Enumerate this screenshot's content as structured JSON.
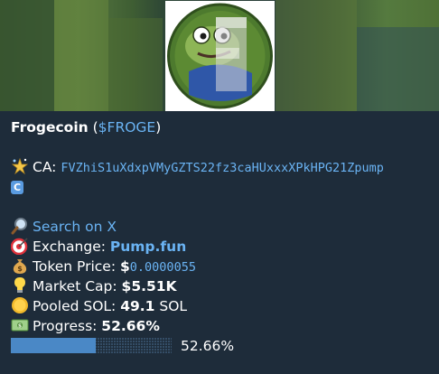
{
  "token": {
    "name": "Frogecoin",
    "ticker_open": " (",
    "ticker": "$FROGE",
    "ticker_close": ")"
  },
  "ca": {
    "label": "CA: ",
    "address": "FVZhiS1uXdxpVMyGZTS22fz3caHUxxxXPkHPG21Zpump",
    "badge": "C"
  },
  "search": {
    "label": "Search on X"
  },
  "exchange": {
    "label": "Exchange: ",
    "value": "Pump.fun"
  },
  "price": {
    "label": "Token Price: ",
    "currency": "$",
    "value": "0.0000055"
  },
  "market_cap": {
    "label": "Market Cap: ",
    "value": "$5.51K"
  },
  "pooled": {
    "label": "Pooled SOL: ",
    "value": "49.1",
    "unit": " SOL"
  },
  "progress": {
    "label": "Progress: ",
    "value": "52.66%",
    "bar_text": "52.66%",
    "fraction": 0.5266
  },
  "colors": {
    "link": "#6ab3f3",
    "background": "#1e2c3a",
    "bar_fill": "#4a88c6"
  },
  "icons": {
    "ca": "sparkle-star-icon",
    "search": "magnifier-icon",
    "exchange": "target-icon",
    "price": "money-bag-icon",
    "market_cap": "light-bulb-icon",
    "pooled": "coin-icon",
    "progress": "banknote-icon"
  }
}
